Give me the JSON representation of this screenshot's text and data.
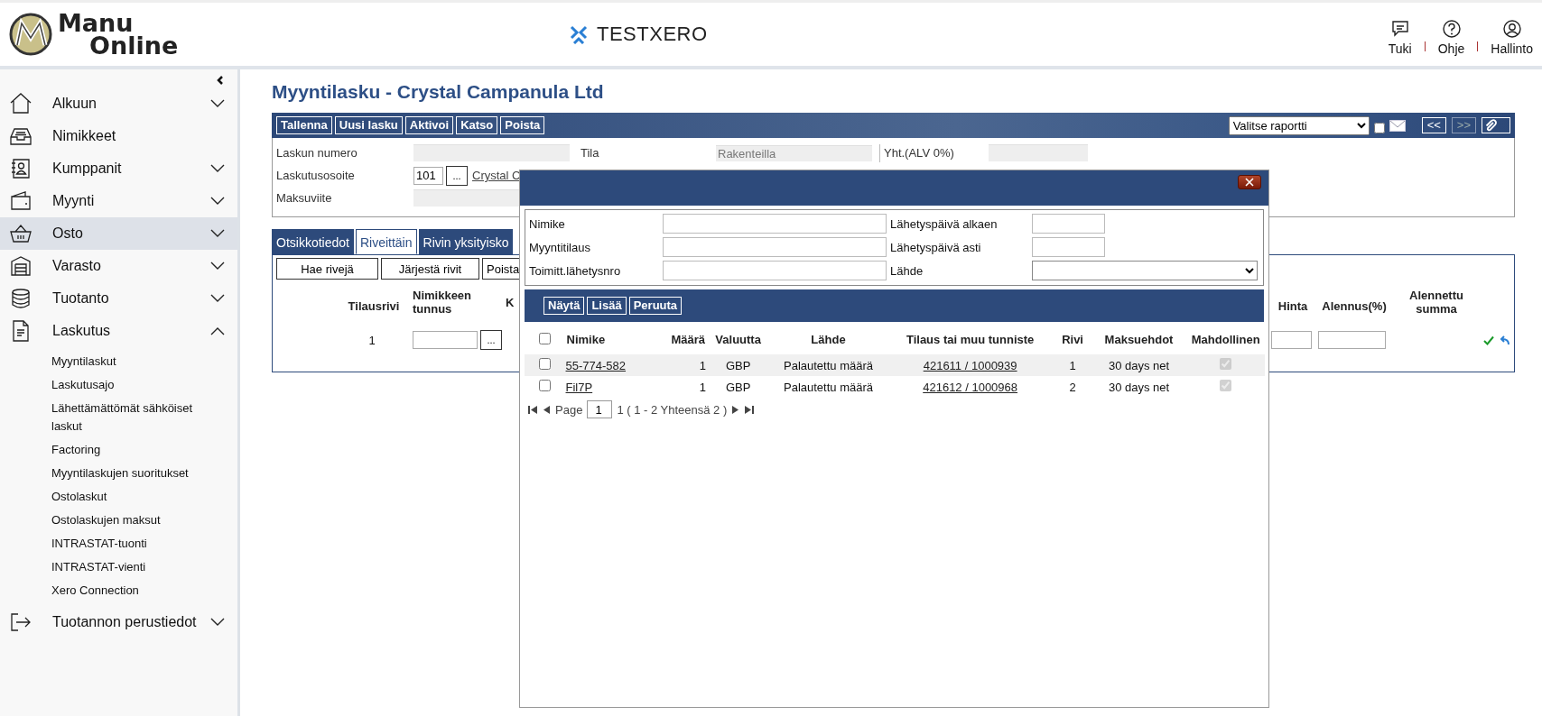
{
  "header": {
    "logo": {
      "line1": "Manu",
      "line2": "Online"
    },
    "company": "TESTXERO",
    "actions": [
      {
        "label": "Tuki"
      },
      {
        "label": "Ohje"
      },
      {
        "label": "Hallinto"
      }
    ]
  },
  "sidebar": {
    "items": [
      {
        "label": "Alkuun",
        "kind": "group",
        "expanded": false,
        "selected": false
      },
      {
        "label": "Nimikkeet",
        "kind": "link",
        "selected": false
      },
      {
        "label": "Kumppanit",
        "kind": "group",
        "expanded": false,
        "selected": false
      },
      {
        "label": "Myynti",
        "kind": "group",
        "expanded": false,
        "selected": false
      },
      {
        "label": "Osto",
        "kind": "group",
        "expanded": false,
        "selected": true
      },
      {
        "label": "Varasto",
        "kind": "group",
        "expanded": false,
        "selected": false
      },
      {
        "label": "Tuotanto",
        "kind": "group",
        "expanded": false,
        "selected": false
      },
      {
        "label": "Laskutus",
        "kind": "group",
        "expanded": true,
        "selected": false,
        "children": [
          "Myyntilaskut",
          "Laskutusajo",
          "Lähettämättömät sähköiset laskut",
          "Factoring",
          "Myyntilaskujen suoritukset",
          "Ostolaskut",
          "Ostolaskujen maksut",
          "INTRASTAT-tuonti",
          "INTRASTAT-vienti",
          "Xero Connection"
        ]
      },
      {
        "label": "Tuotannon perustiedot",
        "kind": "group",
        "expanded": false,
        "selected": false
      }
    ]
  },
  "page": {
    "title": "Myyntilasku - Crystal Campanula Ltd",
    "toolbar": {
      "buttons": [
        "Tallenna",
        "Uusi lasku",
        "Aktivoi",
        "Katso",
        "Poista"
      ],
      "report_select": "Valitse raportti",
      "email_checked": false,
      "nav": [
        {
          "label": "<<",
          "disabled": false
        },
        {
          "label": ">>",
          "disabled": true
        }
      ]
    },
    "form": {
      "invoice_number": {
        "label": "Laskun numero"
      },
      "status": {
        "label": "Tila",
        "value": "Rakenteilla"
      },
      "total": {
        "label": "Yht.(ALV 0%)"
      },
      "billing_address": {
        "label": "Laskutusosoite",
        "code": "101",
        "browse": "...",
        "name": "Crystal C"
      },
      "reference": {
        "label": "Maksuviite"
      }
    },
    "tabs": [
      {
        "label": "Otsikkotiedot",
        "selected": false
      },
      {
        "label": "Riveittäin",
        "selected": true
      },
      {
        "label": "Rivin yksityisko",
        "selected": false
      }
    ],
    "lines": {
      "buttons": [
        "Hae rivejä",
        "Järjestä rivit",
        "Poista"
      ],
      "columns_left": [
        "Tilausrivi",
        "Nimikkeen tunnus",
        "K"
      ],
      "columns_right": [
        "Hinta",
        "Alennus(%)",
        "Alennettu summa"
      ],
      "rows": [
        {
          "line": "1",
          "browse": "..."
        }
      ]
    }
  },
  "dialog": {
    "filters": [
      {
        "label": "Nimike",
        "kind": "text"
      },
      {
        "label": "Lähetyspäivä alkaen",
        "kind": "date"
      },
      {
        "label": "Myyntitilaus",
        "kind": "text"
      },
      {
        "label": "Lähetyspäivä asti",
        "kind": "date"
      },
      {
        "label": "Toimitt.lähetysnro",
        "kind": "text"
      },
      {
        "label": "Lähde",
        "kind": "select"
      }
    ],
    "buttons": [
      "Näytä",
      "Lisää",
      "Peruuta"
    ],
    "select_all": false,
    "columns": [
      "Nimike",
      "Määrä",
      "Valuutta",
      "Lähde",
      "Tilaus tai muu tunniste",
      "Rivi",
      "Maksuehdot",
      "Mahdollinen"
    ],
    "rows": [
      {
        "checked": false,
        "item": "55-774-582",
        "quantity": "1",
        "currency": "GBP",
        "source": "Palautettu määrä",
        "order": "421611 / 1000939",
        "line": "1",
        "terms": "30 days net",
        "available": true
      },
      {
        "checked": false,
        "item": "Fil7P",
        "quantity": "1",
        "currency": "GBP",
        "source": "Palautettu määrä",
        "order": "421612 / 1000968",
        "line": "2",
        "terms": "30 days net",
        "available": true
      }
    ],
    "pager": {
      "label": "Page",
      "page": "1",
      "summary": "1 ( 1 - 2 Yhteensä 2 )"
    }
  }
}
